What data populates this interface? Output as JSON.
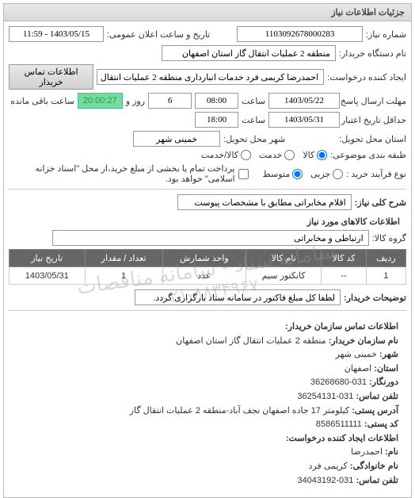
{
  "panel_title": "جزئیات اطلاعات نیاز",
  "fields": {
    "req_number_label": "شماره نیاز:",
    "req_number": "1103092678000283",
    "announce_label": "تاریخ و ساعت اعلان عمومی:",
    "announce_value": "1403/05/15 - 11:59",
    "buyer_label": "نام دستگاه خریدار:",
    "buyer_value": "منطقه 2 عملیات انتقال گاز استان اصفهان",
    "creator_label": "ایجاد کننده درخواست:",
    "creator_value": "احمدرضا کریمی فرد خدمات انبارداری منطقه 2 عملیات انتقال گاز استان اصفهان",
    "contact_btn": "اطلاعات تماس خریدار",
    "deadline_label": "مهلت ارسال پاسخ: تا تاریخ:",
    "deadline_date": "1403/05/22",
    "time_label": "ساعت",
    "deadline_time": "08:00",
    "days_sep": "روز و",
    "days_remain": "6",
    "countdown": "20:00:27",
    "remaining_label": "ساعت باقی مانده",
    "validity_label": "حداقل تاریخ اعتبار قیمت: تا تاریخ:",
    "validity_date": "1403/05/31",
    "validity_time": "18:00",
    "province_label": "استان محل تحویل:",
    "city_label": "شهر محل تحویل:",
    "city_value": "خمینی شهر",
    "category_label": "طبقه بندی موضوعی:",
    "cat_goods": "کالا",
    "cat_service": "خدمت",
    "cat_goods_service": "کالا/خدمت",
    "purchase_type_label": "نوع فرآیند خرید :",
    "pt_small": "جزیی",
    "pt_medium": "متوسط",
    "pt_note": "پرداخت تمام یا بخشی از مبلغ خرید،از محل \"اسناد خزانه اسلامی\" خواهد بود.",
    "desc_label": "شرح کلی نیاز:",
    "desc_value": "اقلام مخابراتی مطابق با مشخصات پیوست",
    "items_title": "اطلاعات کالاهای مورد نیاز",
    "group_label": "گروه کالا:",
    "group_value": "ارتباطی و مخابراتی"
  },
  "table": {
    "headers": [
      "ردیف",
      "کد کالا",
      "نام کالا",
      "واحد شمارش",
      "تعداد / مقدار",
      "تاریخ نیاز"
    ],
    "rows": [
      {
        "c0": "1",
        "c1": "--",
        "c2": "کانکتور سیم",
        "c3": "عدد",
        "c4": "1",
        "c5": "1403/05/31"
      }
    ]
  },
  "buyer_note": {
    "label": "توضیحات خریدار:",
    "value": "لطفا کل مبلغ فاکتور در سامانه ستاد بارگزاری گردد."
  },
  "contact": {
    "title": "اطلاعات تماس سازمان خریدار:",
    "org_label": "نام سازمان خریدار:",
    "org_value": "منطقه 2 عملیات انتقال گاز استان اصفهان",
    "city_label": "شهر:",
    "city_value": "خمینی شهر",
    "province_label": "استان:",
    "province_value": "اصفهان",
    "fax_label": "دورنگار:",
    "fax_value": "031-36268680",
    "phone_label": "تلفن تماس:",
    "phone_value": "031-36254131",
    "address_label": "آدرس پستی:",
    "address_value": "کیلومتر 17 جاده اصفهان نجف آباد-منطقه 2 عملیات انتقال گاز",
    "postal_label": "کد پستی:",
    "postal_value": "8586511111",
    "creator_title": "اطلاعات ایجاد کننده درخواست:",
    "name_label": "نام:",
    "name_value": "احمدرضا",
    "family_label": "نام خانوادگی:",
    "family_value": "کریمی فرد",
    "cphone_label": "تلفن تماس:",
    "cphone_value": "031-34043192"
  },
  "watermark": {
    "line1": "سامانه ستاد - سامانه مناقصات",
    "line2": "۰۲۱-۸۸۳۴۹۶۷"
  }
}
